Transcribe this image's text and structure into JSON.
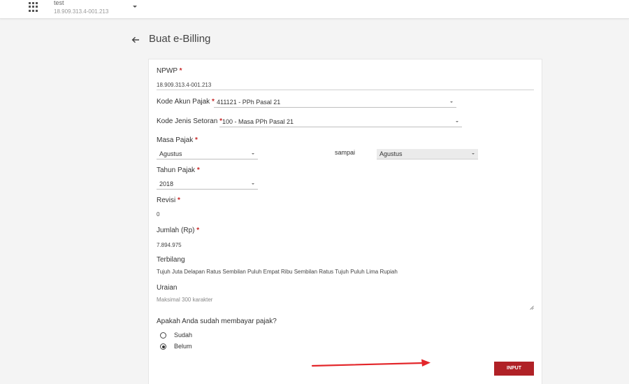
{
  "topbar": {
    "account_name": "test",
    "account_npwp": "18.909.313.4-001.213",
    "apps_icon": "grid-icon",
    "caret_icon": "chevron-down-icon"
  },
  "page": {
    "title": "Buat e-Billing",
    "back_icon": "arrow-left-icon"
  },
  "form": {
    "npwp": {
      "label": "NPWP",
      "value": "18.909.313.4-001.213"
    },
    "kode_akun": {
      "label": "Kode Akun Pajak",
      "value": "411121 - PPh Pasal 21"
    },
    "kode_jenis": {
      "label": "Kode Jenis Setoran",
      "value": "100 - Masa PPh Pasal 21"
    },
    "masa_pajak": {
      "label": "Masa Pajak",
      "from": "Agustus",
      "sampai_label": "sampai",
      "to": "Agustus"
    },
    "tahun_pajak": {
      "label": "Tahun Pajak",
      "value": "2018"
    },
    "revisi": {
      "label": "Revisi",
      "value": "0"
    },
    "jumlah": {
      "label": "Jumlah (Rp)",
      "value": "7.894.975"
    },
    "terbilang": {
      "label": "Terbilang",
      "value": "Tujuh Juta Delapan Ratus Sembilan Puluh Empat Ribu Sembilan Ratus Tujuh Puluh Lima Rupiah"
    },
    "uraian": {
      "label": "Uraian",
      "placeholder": "Maksimal 300 karakter"
    },
    "question": "Apakah Anda sudah membayar pajak?",
    "options": [
      {
        "label": "Sudah",
        "selected": false
      },
      {
        "label": "Belum",
        "selected": true
      }
    ],
    "submit_label": "INPUT"
  },
  "required_mark": "*",
  "colors": {
    "accent": "#b02126",
    "required": "#c62828",
    "arrow": "#e3262a"
  }
}
